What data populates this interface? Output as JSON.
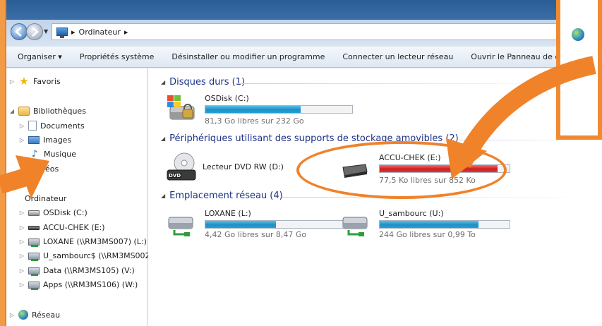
{
  "window": {
    "address": {
      "crumbs": [
        "Ordinateur"
      ]
    },
    "toolbar": {
      "items": [
        "Organiser ▾",
        "Propriétés système",
        "Désinstaller ou modifier un programme",
        "Connecter un lecteur réseau",
        "Ouvrir le Panneau de co"
      ]
    }
  },
  "nav_tree": {
    "favorites": "Favoris",
    "libraries": "Bibliothèques",
    "documents": "Documents",
    "images": "Images",
    "music": "Musique",
    "videos": "éos",
    "computer": "Ordinateur",
    "osdisk": "OSDisk (C:)",
    "accuchek": "ACCU-CHEK (E:)",
    "loxane": "LOXANE (\\\\RM3MS007) (L:)",
    "usambourc": "U_sambourc$ (\\\\RM3MS002",
    "data": "Data (\\\\RM3MS105) (V:)",
    "apps": "Apps (\\\\RM3MS106) (W:)",
    "network": "Réseau"
  },
  "content": {
    "groups": {
      "hard_disks": "Disques durs (1)",
      "removable": "Périphériques utilisant des supports de stockage amovibles (2)",
      "network": "Emplacement réseau (4)"
    },
    "drives": {
      "osdisk": {
        "name": "OSDisk (C:)",
        "free": "81,3 Go libres sur 232 Go",
        "used_fraction": 0.65
      },
      "dvd": {
        "name": "Lecteur DVD RW (D:)",
        "badge": "DVD"
      },
      "accuchek": {
        "name": "ACCU-CHEK (E:)",
        "free": "77,5 Ko libres sur 852 Ko",
        "used_fraction": 0.91
      },
      "loxane": {
        "name": "LOXANE  (L:)",
        "free": "4,42 Go libres sur 8,47 Go",
        "used_fraction": 0.48
      },
      "usambourc": {
        "name": "U_sambourc  (U:)",
        "free": "244 Go libres sur 0,99 To",
        "used_fraction": 0.76
      }
    }
  },
  "colors": {
    "accent_orange": "#f0822a",
    "bar_normal": "#1e8fc4",
    "bar_full": "#d21c1c",
    "group_header": "#1e3287"
  }
}
